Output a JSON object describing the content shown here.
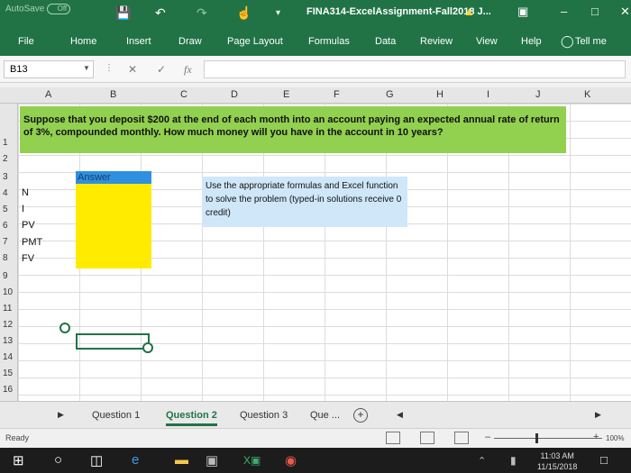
{
  "titlebar": {
    "autosave_label": "AutoSave",
    "autosave_state": "Off",
    "title": "FINA314-ExcelAssignment-Fall2018 J..."
  },
  "ribbon": {
    "tabs": [
      "File",
      "Home",
      "Insert",
      "Draw",
      "Page Layout",
      "Formulas",
      "Data",
      "Review",
      "View",
      "Help"
    ],
    "tell_me": "Tell me"
  },
  "formula_bar": {
    "name_box": "B13",
    "fx_symbol": "fx",
    "formula": ""
  },
  "grid": {
    "columns": [
      "A",
      "B",
      "C",
      "D",
      "E",
      "F",
      "G",
      "H",
      "I",
      "J",
      "K"
    ],
    "rows": [
      "1",
      "2",
      "3",
      "4",
      "5",
      "6",
      "7",
      "8",
      "9",
      "10",
      "11",
      "12",
      "13",
      "14",
      "15",
      "16"
    ],
    "question": "Suppose that you deposit $200 at the end of each month into an account paying an expected annual rate of return of 3%, compounded monthly. How much money will you have in the account in 10 years?",
    "answer_header": "Answer",
    "instructions": "Use the appropriate formulas and Excel function to solve the problem (typed-in solutions receive 0 credit)",
    "labels": [
      "N",
      "I",
      "PV",
      "PMT",
      "FV"
    ]
  },
  "sheets": {
    "tabs": [
      "Question 1",
      "Question 2",
      "Question 3",
      "Que ..."
    ],
    "active": "Question 2"
  },
  "status": {
    "ready": "Ready",
    "zoom": "100%"
  },
  "taskbar": {
    "time": "11:03 AM",
    "date": "11/15/2018"
  },
  "colors": {
    "excel_green": "#217346",
    "question_fill": "#92d050",
    "answer_header_fill": "#2f8fe0",
    "answer_fill": "#ffeb00",
    "instructions_fill": "#cfe7f9"
  }
}
